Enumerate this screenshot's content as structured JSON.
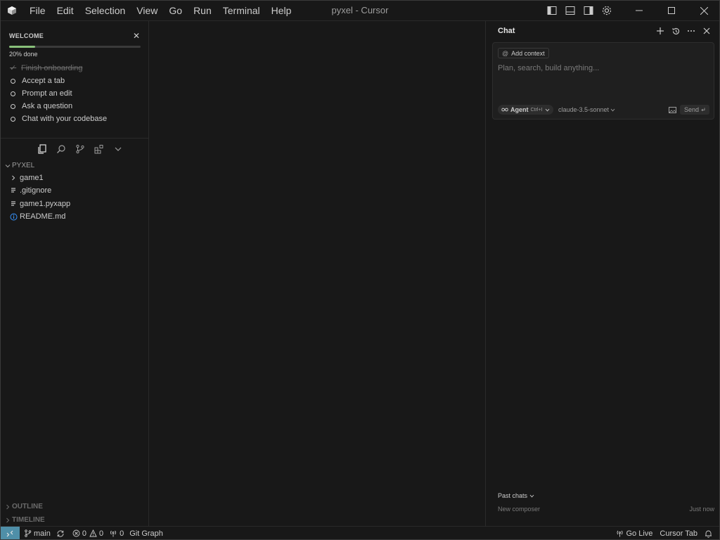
{
  "titlebar": {
    "menu": [
      "File",
      "Edit",
      "Selection",
      "View",
      "Go",
      "Run",
      "Terminal",
      "Help"
    ],
    "window_title": "pyxel - Cursor"
  },
  "welcome": {
    "title": "WELCOME",
    "progress_label": "20% done",
    "progress_fraction": 0.2,
    "tasks": [
      {
        "label": "Finish onboarding",
        "done": true
      },
      {
        "label": "Accept a tab",
        "done": false
      },
      {
        "label": "Prompt an edit",
        "done": false
      },
      {
        "label": "Ask a question",
        "done": false
      },
      {
        "label": "Chat with your codebase",
        "done": false
      }
    ]
  },
  "explorer": {
    "root": "PYXEL",
    "items": [
      {
        "name": "game1",
        "type": "folder"
      },
      {
        "name": ".gitignore",
        "type": "file"
      },
      {
        "name": "game1.pyxapp",
        "type": "file"
      },
      {
        "name": "README.md",
        "type": "info"
      }
    ],
    "outline": "OUTLINE",
    "timeline": "TIMELINE"
  },
  "chat": {
    "tab": "Chat",
    "add_context": "Add context",
    "placeholder": "Plan, search, build anything...",
    "agent_label": "Agent",
    "agent_shortcut": "Ctrl+I",
    "model": "claude-3.5-sonnet",
    "send": "Send",
    "past_chats": "Past chats",
    "new_composer": "New composer",
    "timestamp": "Just now"
  },
  "statusbar": {
    "branch": "main",
    "errors": "0",
    "warnings": "0",
    "ports": "0",
    "git_graph": "Git Graph",
    "go_live": "Go Live",
    "cursor_tab": "Cursor Tab"
  },
  "colors": {
    "background": "#181818",
    "progress": "#89c07a",
    "remote": "#4f8fa8",
    "info": "#3794ff"
  }
}
